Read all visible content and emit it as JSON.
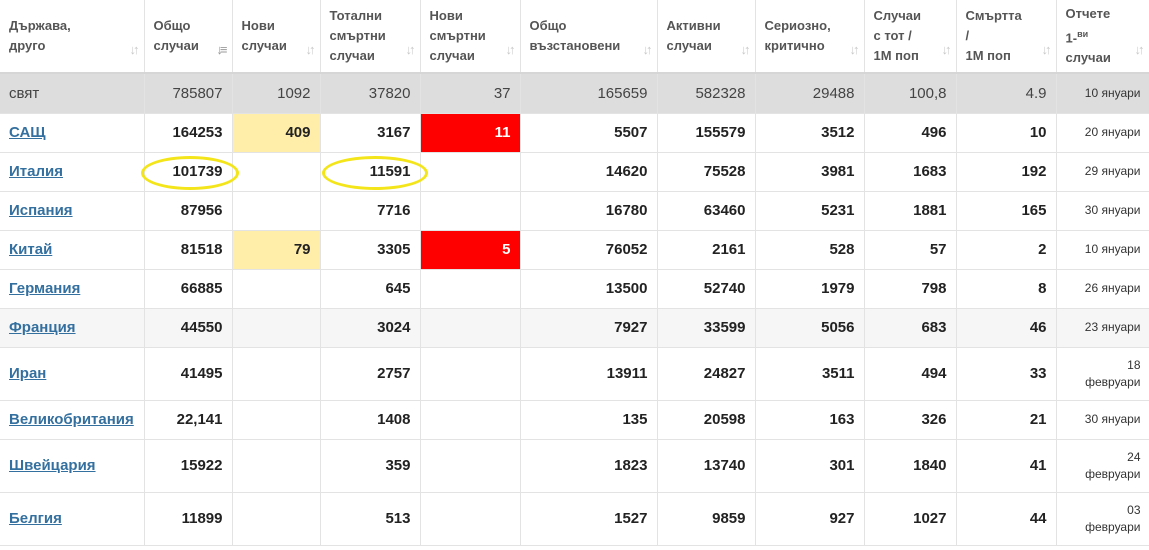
{
  "headers": [
    {
      "l1": "Държава,",
      "l2": "друго",
      "sort_active": false
    },
    {
      "l1": "Общо",
      "l2": "случаи",
      "sort_active": true
    },
    {
      "l1": "Нови",
      "l2": "случаи",
      "sort_active": false
    },
    {
      "l1": "Тотални",
      "l2": "смъртни",
      "l3": "случаи",
      "sort_active": false
    },
    {
      "l1": "Нови",
      "l2": "смъртни",
      "l3": "случаи",
      "sort_active": false
    },
    {
      "l1": "Общо",
      "l2": "възстановени",
      "sort_active": false
    },
    {
      "l1": "Активни",
      "l2": "случаи",
      "sort_active": false
    },
    {
      "l1": "Сериозно,",
      "l2": "критично",
      "sort_active": false
    },
    {
      "l1": "Случаи",
      "l2": "с тот /",
      "l3": "1М поп",
      "sort_active": false
    },
    {
      "l1": "Смъртта",
      "l2": "/",
      "l3": "1М поп",
      "sort_active": false
    },
    {
      "l1": "Отчете",
      "l2a": "1-",
      "l2sup": "ви",
      "l3": "случаи",
      "sort_active": false
    }
  ],
  "world": {
    "country": "свят",
    "total": "785807",
    "new": "1092",
    "deaths": "37820",
    "new_deaths": "37",
    "recovered": "165659",
    "active": "582328",
    "serious": "29488",
    "per_m": "100,8",
    "deaths_per_m": "4.9",
    "first_case": "10 януари"
  },
  "rows": [
    {
      "country": "САЩ",
      "total": "164253",
      "new": "409",
      "deaths": "3167",
      "new_deaths": "11",
      "recovered": "5507",
      "active": "155579",
      "serious": "3512",
      "per_m": "496",
      "deaths_per_m": "10",
      "first_case_l1": "20 януари",
      "first_case_l2": ""
    },
    {
      "country": "Италия",
      "total": "101739",
      "new": "",
      "deaths": "11591",
      "new_deaths": "",
      "recovered": "14620",
      "active": "75528",
      "serious": "3981",
      "per_m": "1683",
      "deaths_per_m": "192",
      "first_case_l1": "29 януари",
      "first_case_l2": ""
    },
    {
      "country": "Испания",
      "total": "87956",
      "new": "",
      "deaths": "7716",
      "new_deaths": "",
      "recovered": "16780",
      "active": "63460",
      "serious": "5231",
      "per_m": "1881",
      "deaths_per_m": "165",
      "first_case_l1": "30 януари",
      "first_case_l2": ""
    },
    {
      "country": "Китай",
      "total": "81518",
      "new": "79",
      "deaths": "3305",
      "new_deaths": "5",
      "recovered": "76052",
      "active": "2161",
      "serious": "528",
      "per_m": "57",
      "deaths_per_m": "2",
      "first_case_l1": "10 януари",
      "first_case_l2": ""
    },
    {
      "country": "Германия",
      "total": "66885",
      "new": "",
      "deaths": "645",
      "new_deaths": "",
      "recovered": "13500",
      "active": "52740",
      "serious": "1979",
      "per_m": "798",
      "deaths_per_m": "8",
      "first_case_l1": "26 януари",
      "first_case_l2": ""
    },
    {
      "country": "Франция",
      "total": "44550",
      "new": "",
      "deaths": "3024",
      "new_deaths": "",
      "recovered": "7927",
      "active": "33599",
      "serious": "5056",
      "per_m": "683",
      "deaths_per_m": "46",
      "first_case_l1": "23 януари",
      "first_case_l2": ""
    },
    {
      "country": "Иран",
      "total": "41495",
      "new": "",
      "deaths": "2757",
      "new_deaths": "",
      "recovered": "13911",
      "active": "24827",
      "serious": "3511",
      "per_m": "494",
      "deaths_per_m": "33",
      "first_case_l1": "18",
      "first_case_l2": "февруари"
    },
    {
      "country": "Великобритания",
      "total": "22,141",
      "new": "",
      "deaths": "1408",
      "new_deaths": "",
      "recovered": "135",
      "active": "20598",
      "serious": "163",
      "per_m": "326",
      "deaths_per_m": "21",
      "first_case_l1": "30 януари",
      "first_case_l2": ""
    },
    {
      "country": "Швейцария",
      "total": "15922",
      "new": "",
      "deaths": "359",
      "new_deaths": "",
      "recovered": "1823",
      "active": "13740",
      "serious": "301",
      "per_m": "1840",
      "deaths_per_m": "41",
      "first_case_l1": "24",
      "first_case_l2": "февруари"
    },
    {
      "country": "Белгия",
      "total": "11899",
      "new": "",
      "deaths": "513",
      "new_deaths": "",
      "recovered": "1527",
      "active": "9859",
      "serious": "927",
      "per_m": "1027",
      "deaths_per_m": "44",
      "first_case_l1": "03",
      "first_case_l2": "февруари"
    }
  ],
  "colors": {
    "highlight_new_cases": "#ffeeaa",
    "highlight_new_deaths": "#ff0000",
    "annotation_circle": "#f3e51a",
    "link": "#34709f"
  }
}
